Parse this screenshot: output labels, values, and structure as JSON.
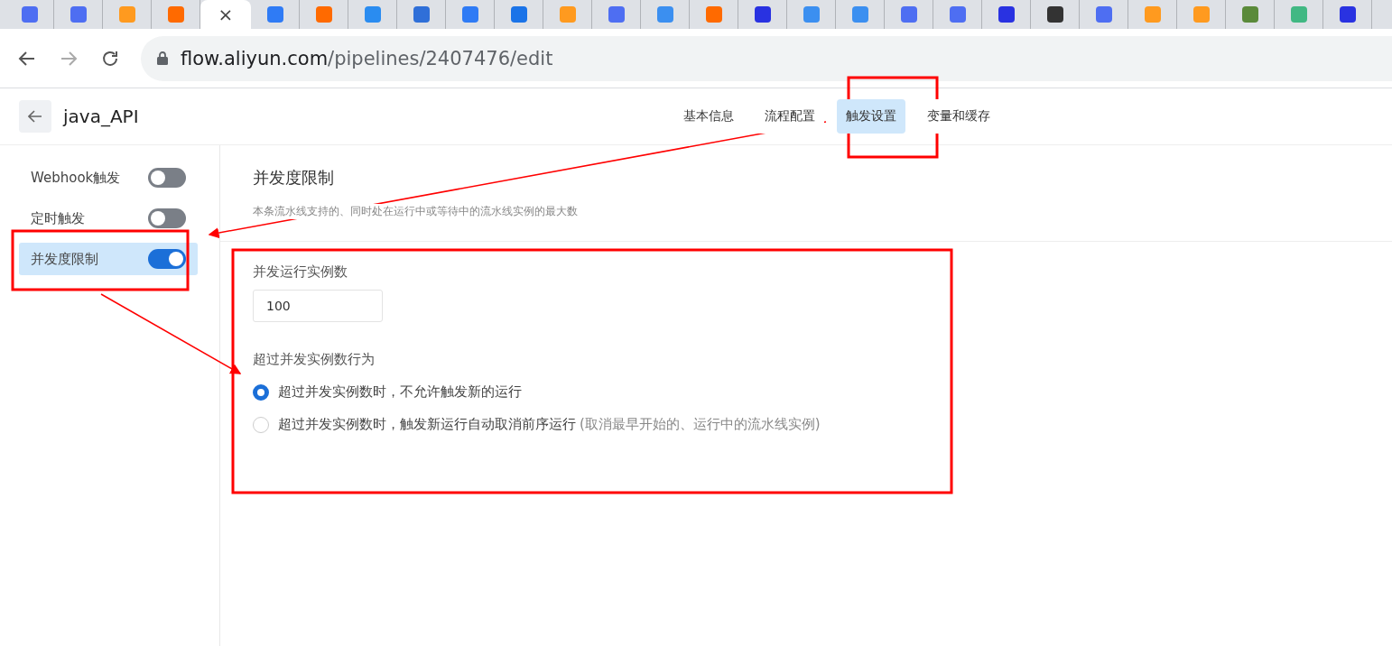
{
  "browser": {
    "tabs": [
      {
        "selected": false
      },
      {
        "selected": false
      },
      {
        "selected": false
      },
      {
        "selected": false
      },
      {
        "selected": true,
        "close": "×"
      },
      {
        "selected": false
      },
      {
        "selected": false
      },
      {
        "selected": false
      },
      {
        "selected": false
      },
      {
        "selected": false
      },
      {
        "selected": false
      },
      {
        "selected": false
      },
      {
        "selected": false
      },
      {
        "selected": false
      },
      {
        "selected": false
      },
      {
        "selected": false
      },
      {
        "selected": false
      },
      {
        "selected": false
      },
      {
        "selected": false
      },
      {
        "selected": false
      },
      {
        "selected": false
      },
      {
        "selected": false
      },
      {
        "selected": false
      },
      {
        "selected": false
      },
      {
        "selected": false
      },
      {
        "selected": false
      },
      {
        "selected": false
      },
      {
        "selected": false
      }
    ],
    "address": {
      "host": "flow.aliyun.com",
      "path": "/pipelines/2407476/edit"
    }
  },
  "header": {
    "title": "java_API",
    "nav": [
      {
        "label": "基本信息",
        "selected": false
      },
      {
        "label": "流程配置",
        "selected": false
      },
      {
        "label": "触发设置",
        "selected": true
      },
      {
        "label": "变量和缓存",
        "selected": false
      }
    ]
  },
  "sidebar": {
    "items": [
      {
        "label": "Webhook触发",
        "on": false,
        "selected": false
      },
      {
        "label": "定时触发",
        "on": false,
        "selected": false
      },
      {
        "label": "并发度限制",
        "on": true,
        "selected": true
      }
    ]
  },
  "section": {
    "title": "并发度限制",
    "description": "本条流水线支持的、同时处在运行中或等待中的流水线实例的最大数",
    "count_label": "并发运行实例数",
    "count_value": "100",
    "behavior_label": "超过并发实例数行为",
    "options": [
      {
        "label": "超过并发实例数时，不允许触发新的运行",
        "selected": true
      },
      {
        "label": "超过并发实例数时，触发新运行自动取消前序运行",
        "note": "(取消最早开始的、运行中的流水线实例)",
        "selected": false
      }
    ]
  }
}
